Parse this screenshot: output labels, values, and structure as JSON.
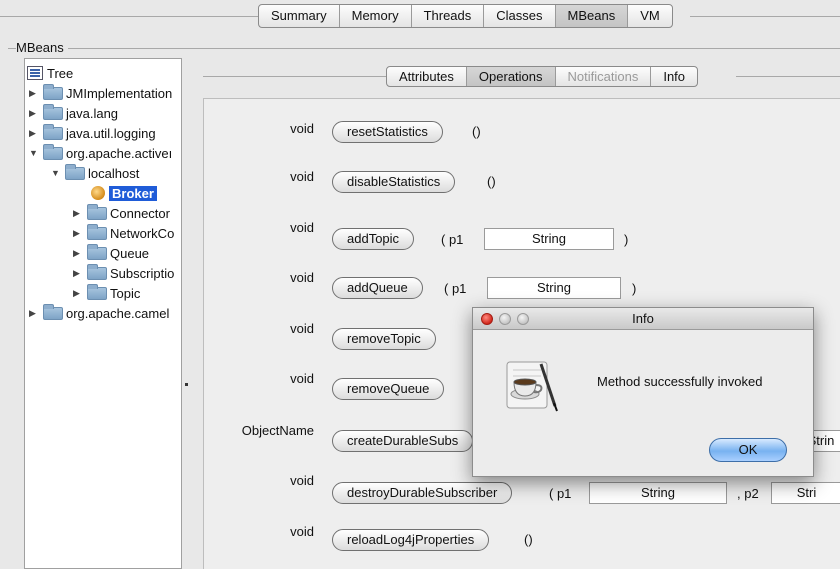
{
  "top_tabs": [
    {
      "label": "Summary",
      "selected": false
    },
    {
      "label": "Memory",
      "selected": false
    },
    {
      "label": "Threads",
      "selected": false
    },
    {
      "label": "Classes",
      "selected": false
    },
    {
      "label": "MBeans",
      "selected": true
    },
    {
      "label": "VM",
      "selected": false
    }
  ],
  "group_label": "MBeans",
  "tree": {
    "root": "Tree",
    "nodes": [
      {
        "label": "JMImplementation",
        "icon": "folder-icon"
      },
      {
        "label": "java.lang",
        "icon": "folder-icon"
      },
      {
        "label": "java.util.logging",
        "icon": "folder-icon"
      },
      {
        "label": "org.apache.activeı",
        "icon": "folder-icon",
        "expanded": true
      },
      {
        "label": "localhost",
        "icon": "folder-icon",
        "expanded": true
      },
      {
        "label": "Broker",
        "icon": "bean-icon",
        "selected": true
      },
      {
        "label": "Connector",
        "icon": "folder-icon"
      },
      {
        "label": "NetworkCo",
        "icon": "folder-icon"
      },
      {
        "label": "Queue",
        "icon": "folder-icon"
      },
      {
        "label": "Subscriptio",
        "icon": "folder-icon"
      },
      {
        "label": "Topic",
        "icon": "folder-icon"
      },
      {
        "label": "org.apache.camel",
        "icon": "folder-icon"
      }
    ]
  },
  "detail_tabs": [
    {
      "label": "Attributes",
      "selected": false,
      "disabled": false
    },
    {
      "label": "Operations",
      "selected": true,
      "disabled": false
    },
    {
      "label": "Notifications",
      "selected": false,
      "disabled": true
    },
    {
      "label": "Info",
      "selected": false,
      "disabled": false
    }
  ],
  "operations": [
    {
      "return_type": "void",
      "name": "resetStatistics",
      "params": "()"
    },
    {
      "return_type": "void",
      "name": "disableStatistics",
      "params": "()"
    },
    {
      "return_type": "void",
      "name": "addTopic",
      "p1_label": "( p1",
      "p1_value": "String",
      "close": ")"
    },
    {
      "return_type": "void",
      "name": "addQueue",
      "p1_label": "( p1",
      "p1_value": "String",
      "close": ")"
    },
    {
      "return_type": "void",
      "name": "removeTopic"
    },
    {
      "return_type": "void",
      "name": "removeQueue"
    },
    {
      "return_type": "ObjectName",
      "name": "createDurableSubs",
      "tail_value": "Strin"
    },
    {
      "return_type": "void",
      "name": "destroyDurableSubscriber",
      "p1_label": "( p1",
      "p1_value": "String",
      "p2_label": ", p2",
      "p2_value": "Stri"
    },
    {
      "return_type": "void",
      "name": "reloadLog4jProperties",
      "params": "()"
    }
  ],
  "dialog": {
    "title": "Info",
    "message": "Method successfully invoked",
    "ok_label": "OK",
    "icon": "java-coffee-cup-icon"
  }
}
